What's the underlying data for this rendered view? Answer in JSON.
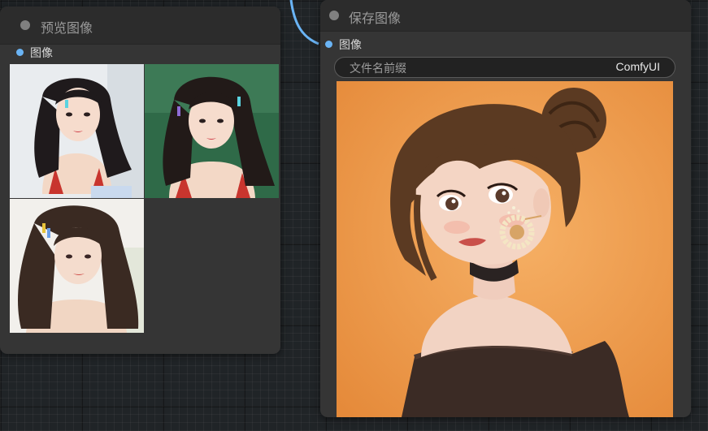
{
  "preview_node": {
    "title": "预览图像",
    "input_label": "图像",
    "images": [
      {
        "icon": "portrait-photo-icon"
      },
      {
        "icon": "portrait-photo-icon"
      },
      {
        "icon": "portrait-photo-icon"
      }
    ]
  },
  "save_node": {
    "title": "保存图像",
    "input_label": "图像",
    "filename_prefix": {
      "label": "文件名前缀",
      "value": "ComfyUI"
    },
    "image": {
      "icon": "illustrated-portrait-icon"
    }
  },
  "colors": {
    "canvas": "#202427",
    "node_body": "#353535",
    "node_header": "#2c2c2c",
    "link_blue": "#6ab4f5",
    "image_background_orange": "#f4a155"
  }
}
